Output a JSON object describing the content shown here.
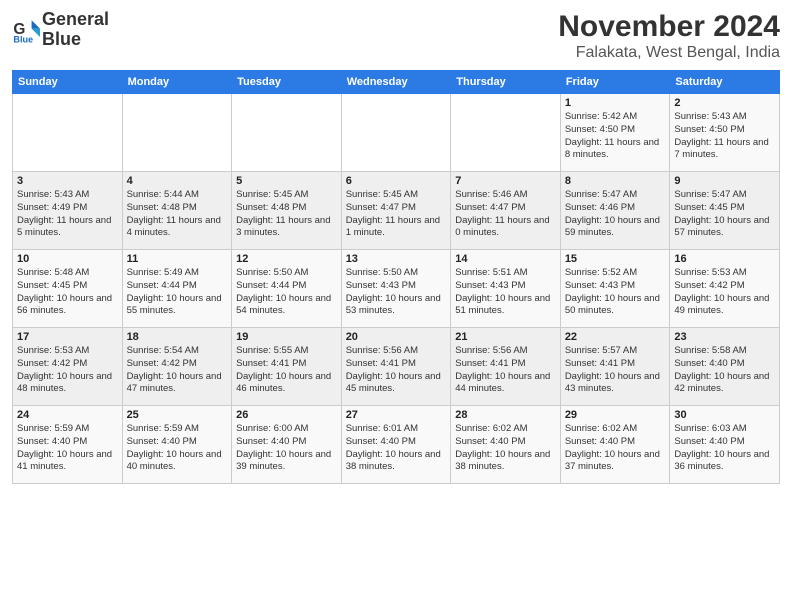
{
  "logo": {
    "line1": "General",
    "line2": "Blue"
  },
  "title": "November 2024",
  "subtitle": "Falakata, West Bengal, India",
  "weekdays": [
    "Sunday",
    "Monday",
    "Tuesday",
    "Wednesday",
    "Thursday",
    "Friday",
    "Saturday"
  ],
  "weeks": [
    [
      {
        "day": "",
        "info": ""
      },
      {
        "day": "",
        "info": ""
      },
      {
        "day": "",
        "info": ""
      },
      {
        "day": "",
        "info": ""
      },
      {
        "day": "",
        "info": ""
      },
      {
        "day": "1",
        "info": "Sunrise: 5:42 AM\nSunset: 4:50 PM\nDaylight: 11 hours and 8 minutes."
      },
      {
        "day": "2",
        "info": "Sunrise: 5:43 AM\nSunset: 4:50 PM\nDaylight: 11 hours and 7 minutes."
      }
    ],
    [
      {
        "day": "3",
        "info": "Sunrise: 5:43 AM\nSunset: 4:49 PM\nDaylight: 11 hours and 5 minutes."
      },
      {
        "day": "4",
        "info": "Sunrise: 5:44 AM\nSunset: 4:48 PM\nDaylight: 11 hours and 4 minutes."
      },
      {
        "day": "5",
        "info": "Sunrise: 5:45 AM\nSunset: 4:48 PM\nDaylight: 11 hours and 3 minutes."
      },
      {
        "day": "6",
        "info": "Sunrise: 5:45 AM\nSunset: 4:47 PM\nDaylight: 11 hours and 1 minute."
      },
      {
        "day": "7",
        "info": "Sunrise: 5:46 AM\nSunset: 4:47 PM\nDaylight: 11 hours and 0 minutes."
      },
      {
        "day": "8",
        "info": "Sunrise: 5:47 AM\nSunset: 4:46 PM\nDaylight: 10 hours and 59 minutes."
      },
      {
        "day": "9",
        "info": "Sunrise: 5:47 AM\nSunset: 4:45 PM\nDaylight: 10 hours and 57 minutes."
      }
    ],
    [
      {
        "day": "10",
        "info": "Sunrise: 5:48 AM\nSunset: 4:45 PM\nDaylight: 10 hours and 56 minutes."
      },
      {
        "day": "11",
        "info": "Sunrise: 5:49 AM\nSunset: 4:44 PM\nDaylight: 10 hours and 55 minutes."
      },
      {
        "day": "12",
        "info": "Sunrise: 5:50 AM\nSunset: 4:44 PM\nDaylight: 10 hours and 54 minutes."
      },
      {
        "day": "13",
        "info": "Sunrise: 5:50 AM\nSunset: 4:43 PM\nDaylight: 10 hours and 53 minutes."
      },
      {
        "day": "14",
        "info": "Sunrise: 5:51 AM\nSunset: 4:43 PM\nDaylight: 10 hours and 51 minutes."
      },
      {
        "day": "15",
        "info": "Sunrise: 5:52 AM\nSunset: 4:43 PM\nDaylight: 10 hours and 50 minutes."
      },
      {
        "day": "16",
        "info": "Sunrise: 5:53 AM\nSunset: 4:42 PM\nDaylight: 10 hours and 49 minutes."
      }
    ],
    [
      {
        "day": "17",
        "info": "Sunrise: 5:53 AM\nSunset: 4:42 PM\nDaylight: 10 hours and 48 minutes."
      },
      {
        "day": "18",
        "info": "Sunrise: 5:54 AM\nSunset: 4:42 PM\nDaylight: 10 hours and 47 minutes."
      },
      {
        "day": "19",
        "info": "Sunrise: 5:55 AM\nSunset: 4:41 PM\nDaylight: 10 hours and 46 minutes."
      },
      {
        "day": "20",
        "info": "Sunrise: 5:56 AM\nSunset: 4:41 PM\nDaylight: 10 hours and 45 minutes."
      },
      {
        "day": "21",
        "info": "Sunrise: 5:56 AM\nSunset: 4:41 PM\nDaylight: 10 hours and 44 minutes."
      },
      {
        "day": "22",
        "info": "Sunrise: 5:57 AM\nSunset: 4:41 PM\nDaylight: 10 hours and 43 minutes."
      },
      {
        "day": "23",
        "info": "Sunrise: 5:58 AM\nSunset: 4:40 PM\nDaylight: 10 hours and 42 minutes."
      }
    ],
    [
      {
        "day": "24",
        "info": "Sunrise: 5:59 AM\nSunset: 4:40 PM\nDaylight: 10 hours and 41 minutes."
      },
      {
        "day": "25",
        "info": "Sunrise: 5:59 AM\nSunset: 4:40 PM\nDaylight: 10 hours and 40 minutes."
      },
      {
        "day": "26",
        "info": "Sunrise: 6:00 AM\nSunset: 4:40 PM\nDaylight: 10 hours and 39 minutes."
      },
      {
        "day": "27",
        "info": "Sunrise: 6:01 AM\nSunset: 4:40 PM\nDaylight: 10 hours and 38 minutes."
      },
      {
        "day": "28",
        "info": "Sunrise: 6:02 AM\nSunset: 4:40 PM\nDaylight: 10 hours and 38 minutes."
      },
      {
        "day": "29",
        "info": "Sunrise: 6:02 AM\nSunset: 4:40 PM\nDaylight: 10 hours and 37 minutes."
      },
      {
        "day": "30",
        "info": "Sunrise: 6:03 AM\nSunset: 4:40 PM\nDaylight: 10 hours and 36 minutes."
      }
    ]
  ]
}
